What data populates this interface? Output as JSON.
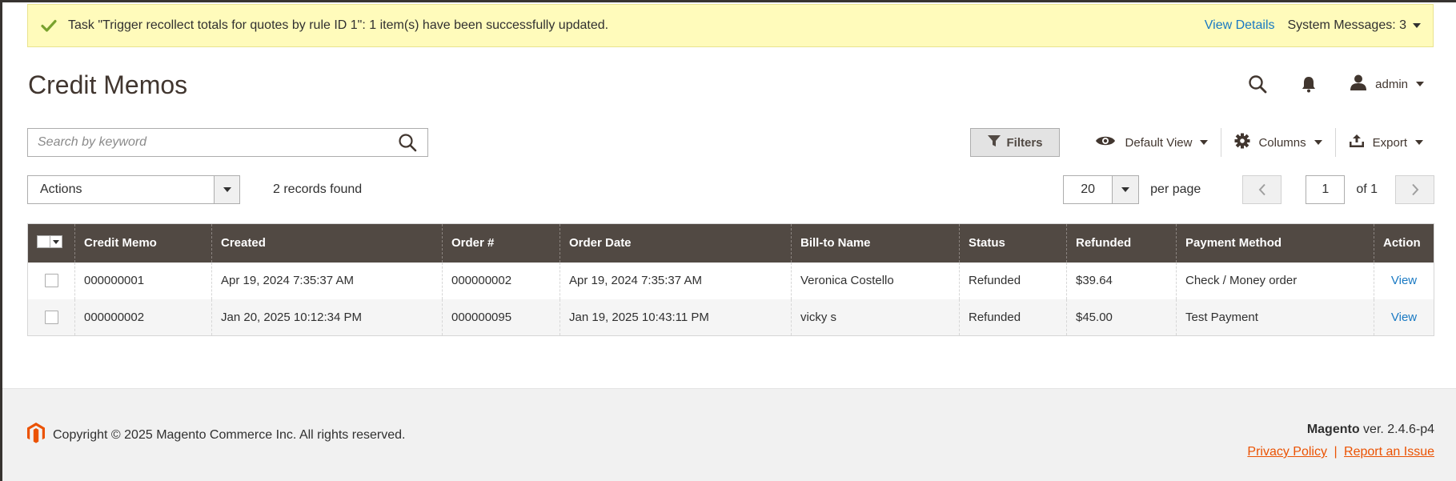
{
  "message": {
    "text": "Task \"Trigger recollect totals for quotes by rule ID 1\": 1 item(s) have been successfully updated.",
    "view_details": "View Details",
    "system_messages": "System Messages: 3"
  },
  "header": {
    "title": "Credit Memos",
    "user": "admin"
  },
  "search": {
    "placeholder": "Search by keyword",
    "value": ""
  },
  "toolbar": {
    "filters": "Filters",
    "view": "Default View",
    "columns": "Columns",
    "export": "Export"
  },
  "actions": {
    "label": "Actions",
    "records": "2 records found"
  },
  "pager": {
    "per_page_value": "20",
    "per_page_label": "per page",
    "page": "1",
    "of": "of 1"
  },
  "grid": {
    "columns": [
      "Credit Memo",
      "Created",
      "Order #",
      "Order Date",
      "Bill-to Name",
      "Status",
      "Refunded",
      "Payment Method",
      "Action"
    ],
    "rows": [
      [
        "000000001",
        "Apr 19, 2024 7:35:37 AM",
        "000000002",
        "Apr 19, 2024 7:35:37 AM",
        "Veronica Costello",
        "Refunded",
        "$39.64",
        "Check / Money order",
        "View"
      ],
      [
        "000000002",
        "Jan 20, 2025 10:12:34 PM",
        "000000095",
        "Jan 19, 2025 10:43:11 PM",
        "vicky s",
        "Refunded",
        "$45.00",
        "Test Payment",
        "View"
      ]
    ]
  },
  "footer": {
    "copyright": "Copyright © 2025 Magento Commerce Inc. All rights reserved.",
    "brand": "Magento",
    "version": "ver. 2.4.6-p4",
    "privacy": "Privacy Policy",
    "separator": "|",
    "report": "Report an Issue"
  },
  "colors": {
    "header_bg": "#514943",
    "link": "#1979c3",
    "footer_link": "#eb5202",
    "success": "#79a22e",
    "message_bg": "#fffbbb"
  },
  "icons": [
    "check-icon",
    "search-icon",
    "bell-icon",
    "user-icon",
    "filter-icon",
    "eye-icon",
    "gear-icon",
    "export-icon",
    "chevron-left-icon",
    "chevron-right-icon",
    "magento-logo-icon"
  ]
}
